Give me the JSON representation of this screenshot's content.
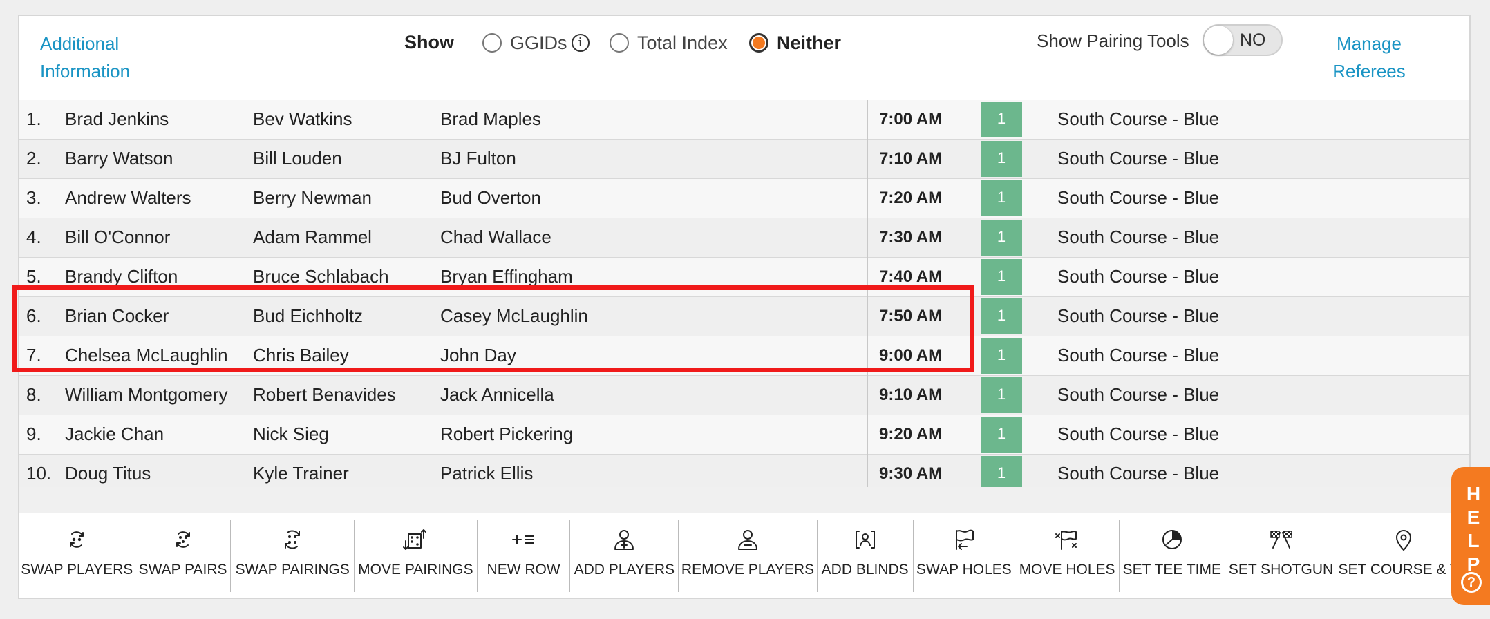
{
  "header": {
    "additional_info": [
      "Additional",
      "Information"
    ],
    "show_label": "Show",
    "options": [
      {
        "label": "GGIDs",
        "selected": false
      },
      {
        "label": "Total Index",
        "selected": false
      },
      {
        "label": "Neither",
        "selected": true
      }
    ],
    "info_icon": "i",
    "show_pairing_tools_label": "Show Pairing Tools",
    "pairing_tools_toggle": "NO",
    "manage_referees": [
      "Manage",
      "Referees"
    ]
  },
  "pairings": [
    {
      "num": "1.",
      "p1": "Brad Jenkins",
      "p2": "Bev Watkins",
      "p3": "Brad Maples",
      "time": "7:00 AM",
      "hole": "1",
      "course": "South Course - Blue"
    },
    {
      "num": "2.",
      "p1": "Barry Watson",
      "p2": "Bill Louden",
      "p3": "BJ Fulton",
      "time": "7:10 AM",
      "hole": "1",
      "course": "South Course - Blue"
    },
    {
      "num": "3.",
      "p1": "Andrew Walters",
      "p2": "Berry Newman",
      "p3": "Bud Overton",
      "time": "7:20 AM",
      "hole": "1",
      "course": "South Course - Blue"
    },
    {
      "num": "4.",
      "p1": "Bill O'Connor",
      "p2": "Adam Rammel",
      "p3": "Chad Wallace",
      "time": "7:30 AM",
      "hole": "1",
      "course": "South Course - Blue"
    },
    {
      "num": "5.",
      "p1": "Brandy Clifton",
      "p2": "Bruce Schlabach",
      "p3": "Bryan Effingham",
      "time": "7:40 AM",
      "hole": "1",
      "course": "South Course - Blue"
    },
    {
      "num": "6.",
      "p1": "Brian Cocker",
      "p2": "Bud Eichholtz",
      "p3": "Casey McLaughlin",
      "time": "7:50 AM",
      "hole": "1",
      "course": "South Course - Blue"
    },
    {
      "num": "7.",
      "p1": "Chelsea McLaughlin",
      "p2": "Chris Bailey",
      "p3": "John Day",
      "time": "9:00 AM",
      "hole": "1",
      "course": "South Course - Blue"
    },
    {
      "num": "8.",
      "p1": "William Montgomery",
      "p2": "Robert Benavides",
      "p3": "Jack Annicella",
      "time": "9:10 AM",
      "hole": "1",
      "course": "South Course - Blue"
    },
    {
      "num": "9.",
      "p1": "Jackie Chan",
      "p2": "Nick Sieg",
      "p3": "Robert Pickering",
      "time": "9:20 AM",
      "hole": "1",
      "course": "South Course - Blue"
    },
    {
      "num": "10.",
      "p1": "Doug Titus",
      "p2": "Kyle Trainer",
      "p3": "Patrick Ellis",
      "time": "9:30 AM",
      "hole": "1",
      "course": "South Course - Blue"
    }
  ],
  "toolbar": [
    {
      "label": "SWAP PLAYERS",
      "icon": "swap-players-icon"
    },
    {
      "label": "SWAP PAIRS",
      "icon": "swap-pairs-icon"
    },
    {
      "label": "SWAP PAIRINGS",
      "icon": "swap-pairings-icon"
    },
    {
      "label": "MOVE PAIRINGS",
      "icon": "move-pairings-icon"
    },
    {
      "label": "NEW ROW",
      "icon": "new-row-icon"
    },
    {
      "label": "ADD PLAYERS",
      "icon": "add-players-icon"
    },
    {
      "label": "REMOVE PLAYERS",
      "icon": "remove-players-icon"
    },
    {
      "label": "ADD BLINDS",
      "icon": "add-blinds-icon"
    },
    {
      "label": "SWAP HOLES",
      "icon": "swap-holes-icon"
    },
    {
      "label": "MOVE HOLES",
      "icon": "move-holes-icon"
    },
    {
      "label": "SET TEE TIME",
      "icon": "set-tee-time-icon"
    },
    {
      "label": "SET SHOTGUN",
      "icon": "set-shotgun-icon"
    },
    {
      "label": "SET COURSE & TE",
      "icon": "set-course-icon"
    }
  ],
  "help": {
    "letters": [
      "H",
      "E",
      "L",
      "P"
    ],
    "icon": "?"
  },
  "colors": {
    "accent_link": "#1a94c4",
    "radio_selected": "#f47a20",
    "hole_badge": "#6cb78d",
    "highlight": "#f01a1a",
    "help_tab": "#f47a20"
  }
}
